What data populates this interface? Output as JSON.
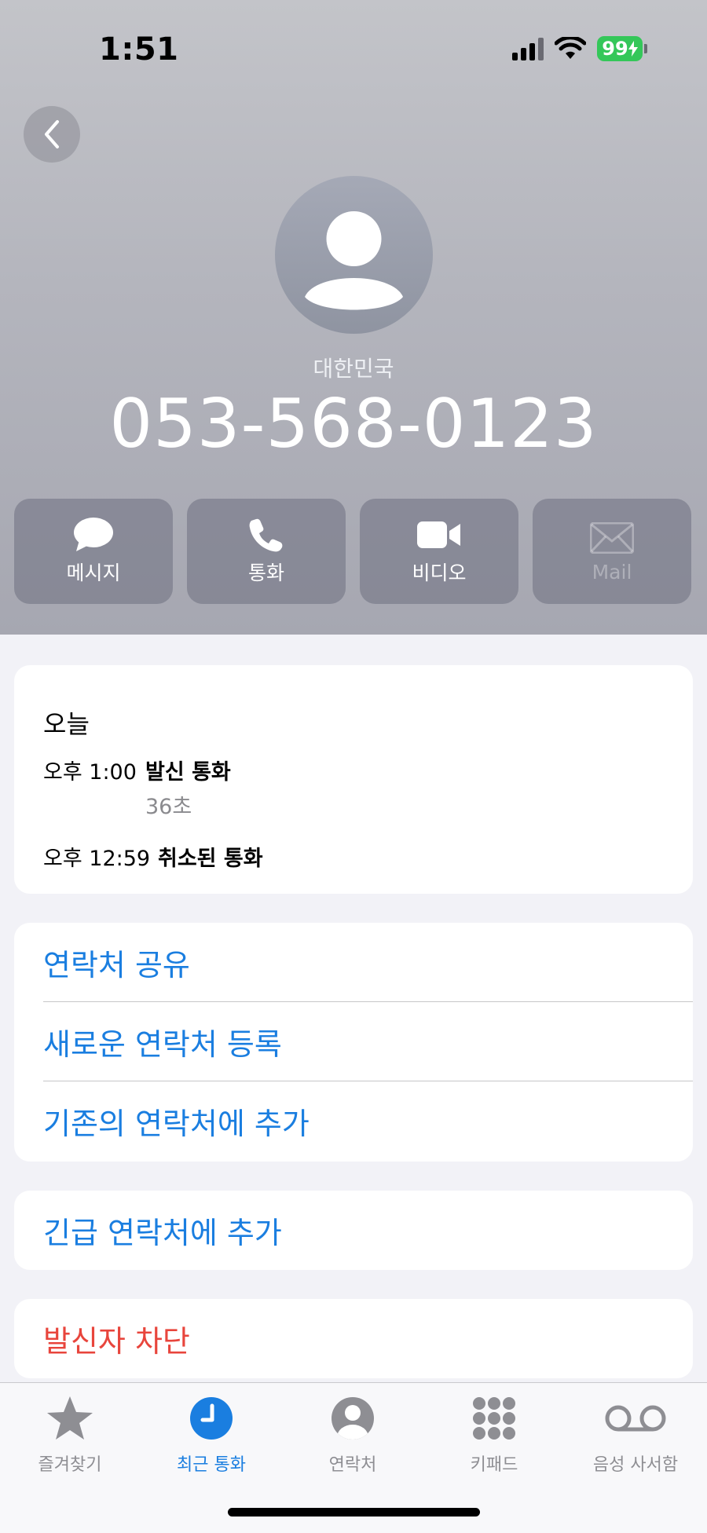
{
  "status_bar": {
    "time": "1:51",
    "battery": "99"
  },
  "contact": {
    "country": "대한민국",
    "phone_number": "053-568-0123"
  },
  "actions": [
    {
      "label": "메시지",
      "icon": "message-bubble-icon",
      "enabled": true
    },
    {
      "label": "통화",
      "icon": "phone-icon",
      "enabled": true
    },
    {
      "label": "비디오",
      "icon": "video-camera-icon",
      "enabled": true
    },
    {
      "label": "Mail",
      "icon": "mail-envelope-icon",
      "enabled": false
    }
  ],
  "call_history": {
    "day": "오늘",
    "calls": [
      {
        "time": "오후 1:00",
        "type": "발신 통화",
        "duration": "36초"
      },
      {
        "time": "오후 12:59",
        "type": "취소된 통화",
        "duration": ""
      }
    ]
  },
  "options": {
    "share_contact": "연락처 공유",
    "create_new_contact": "새로운 연락처 등록",
    "add_to_existing": "기존의 연락처에 추가",
    "add_to_emergency": "긴급 연락처에 추가",
    "block_caller": "발신자 차단"
  },
  "tabbar": {
    "items": [
      {
        "label": "즐겨찾기",
        "icon": "star-icon",
        "active": false
      },
      {
        "label": "최근 통화",
        "icon": "clock-icon",
        "active": true
      },
      {
        "label": "연락처",
        "icon": "person-circle-icon",
        "active": false
      },
      {
        "label": "키패드",
        "icon": "keypad-icon",
        "active": false
      },
      {
        "label": "음성 사서함",
        "icon": "voicemail-icon",
        "active": false
      }
    ]
  },
  "colors": {
    "accent": "#1a7ee0",
    "destructive": "#e8453c",
    "battery": "#34c759"
  }
}
